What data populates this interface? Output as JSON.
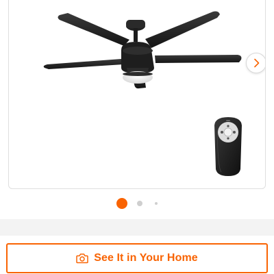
{
  "gallery": {
    "image_alt": "Black 5-blade ceiling fan with light kit and remote control",
    "next_icon": "chevron-right-icon",
    "dots": [
      {
        "state": "active"
      },
      {
        "state": "inactive"
      },
      {
        "state": "inactive"
      }
    ]
  },
  "cta": {
    "label": "See It in Your Home",
    "icon": "camera-icon"
  },
  "colors": {
    "accent": "#f96302",
    "dot_inactive": "#cfcfcf",
    "fan_body": "#1f1f1f"
  }
}
